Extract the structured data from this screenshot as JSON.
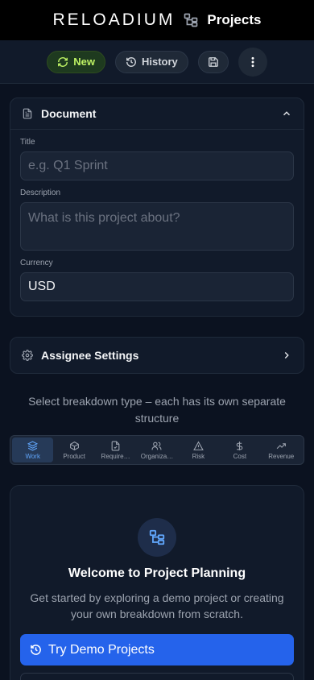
{
  "header": {
    "brand": "RELOADIUM",
    "app_title": "Projects",
    "app_icon": "tree-structure-icon"
  },
  "toolbar": {
    "new_label": "New",
    "history_label": "History",
    "save_icon": "save-icon",
    "more_icon": "more-vertical-icon"
  },
  "document": {
    "section_title": "Document",
    "title_label": "Title",
    "title_placeholder": "e.g. Q1 Sprint",
    "description_label": "Description",
    "description_placeholder": "What is this project about?",
    "currency_label": "Currency",
    "currency_value": "USD"
  },
  "assignee": {
    "section_title": "Assignee Settings"
  },
  "breakdown": {
    "helper_text": "Select breakdown type – each has its own separate structure",
    "tabs": [
      {
        "label": "Work",
        "icon": "layers-icon",
        "active": true
      },
      {
        "label": "Product",
        "icon": "package-icon",
        "active": false
      },
      {
        "label": "Require…",
        "icon": "file-check-icon",
        "active": false
      },
      {
        "label": "Organiza…",
        "icon": "users-icon",
        "active": false
      },
      {
        "label": "Risk",
        "icon": "warning-icon",
        "active": false
      },
      {
        "label": "Cost",
        "icon": "dollar-icon",
        "active": false
      },
      {
        "label": "Revenue",
        "icon": "trending-up-icon",
        "active": false
      }
    ]
  },
  "welcome": {
    "title": "Welcome to Project Planning",
    "description": "Get started by exploring a demo project or creating your own breakdown from scratch.",
    "demo_button": "Try Demo Projects"
  },
  "colors": {
    "background": "#0b1220",
    "accent": "#2563eb",
    "new_button": "#bef264"
  }
}
